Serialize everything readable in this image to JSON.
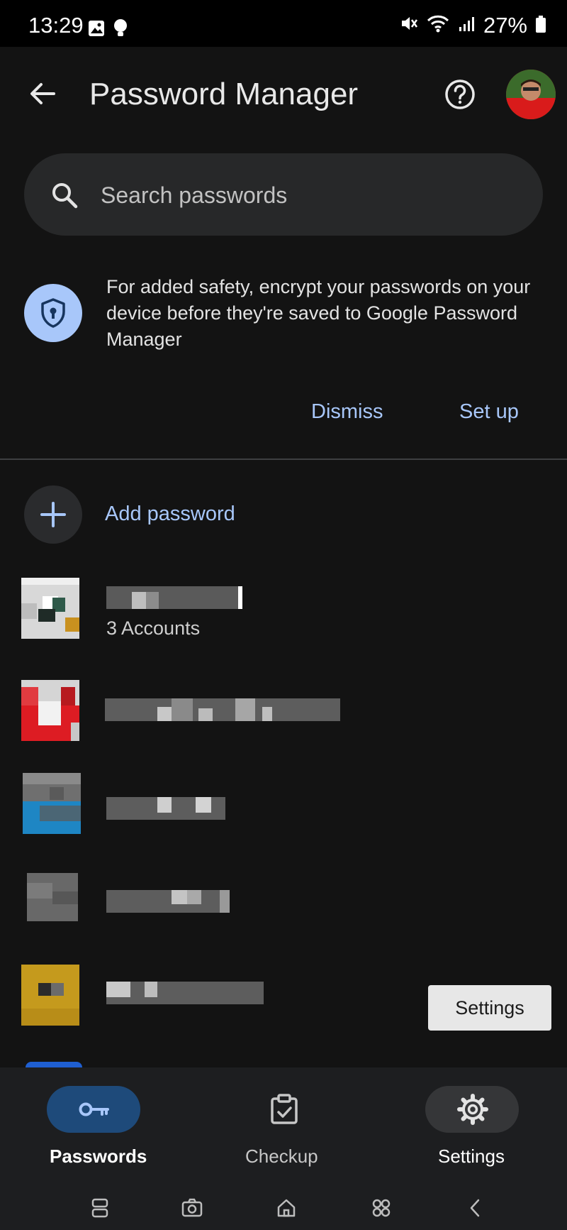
{
  "status_bar": {
    "time": "13:29",
    "battery": "27%"
  },
  "app_bar": {
    "title": "Password Manager"
  },
  "search": {
    "placeholder": "Search passwords"
  },
  "banner": {
    "text": "For added safety, encrypt your passwords on your device before they're saved to Google Password Manager",
    "dismiss_label": "Dismiss",
    "setup_label": "Set up"
  },
  "add_password": {
    "label": "Add password"
  },
  "list": [
    {
      "subtitle": "3 Accounts"
    }
  ],
  "tooltip": {
    "text": "Settings"
  },
  "bottom_nav": {
    "items": [
      {
        "label": "Passwords"
      },
      {
        "label": "Checkup"
      },
      {
        "label": "Settings"
      }
    ]
  },
  "colors": {
    "accent": "#a8c7fa",
    "selected_pill": "#1e4a7a",
    "background": "#131313"
  }
}
